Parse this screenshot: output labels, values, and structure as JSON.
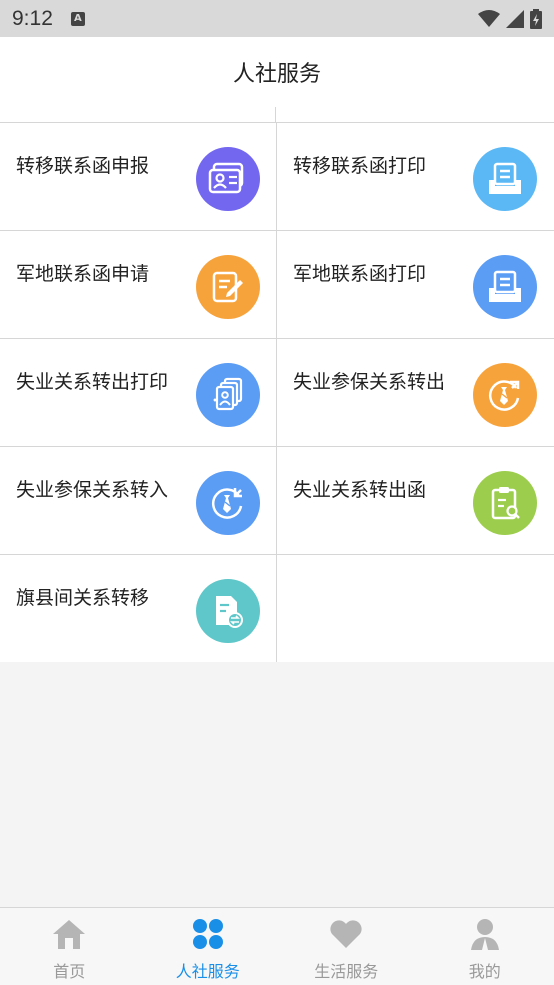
{
  "status_bar": {
    "time": "9:12",
    "notification_letter": "A"
  },
  "header": {
    "title": "人社服务"
  },
  "services": [
    {
      "label": "转移联系函申报",
      "icon": "id-card-icon",
      "color": "#7367f0"
    },
    {
      "label": "转移联系函打印",
      "icon": "printer-icon",
      "color": "#5bb8f5"
    },
    {
      "label": "军地联系函申请",
      "icon": "edit-note-icon",
      "color": "#f7a33c"
    },
    {
      "label": "军地联系函打印",
      "icon": "printer-icon",
      "color": "#5b9cf5"
    },
    {
      "label": "失业关系转出打印",
      "icon": "document-stack-icon",
      "color": "#5b9cf5"
    },
    {
      "label": "失业参保关系转出",
      "icon": "tie-transfer-out-icon",
      "color": "#f7a33c"
    },
    {
      "label": "失业参保关系转入",
      "icon": "tie-transfer-in-icon",
      "color": "#5b9cf5"
    },
    {
      "label": "失业关系转出函",
      "icon": "clipboard-search-icon",
      "color": "#9ccd4c"
    },
    {
      "label": "旗县间关系转移",
      "icon": "file-transfer-icon",
      "color": "#5fc7c9"
    }
  ],
  "tabs": [
    {
      "label": "首页",
      "icon": "home-icon",
      "active": false
    },
    {
      "label": "人社服务",
      "icon": "four-petal-icon",
      "active": true
    },
    {
      "label": "生活服务",
      "icon": "heart-icon",
      "active": false
    },
    {
      "label": "我的",
      "icon": "person-icon",
      "active": false
    }
  ],
  "colors": {
    "active_tab": "#1a8fe8",
    "inactive_tab": "#b5b5b5"
  }
}
